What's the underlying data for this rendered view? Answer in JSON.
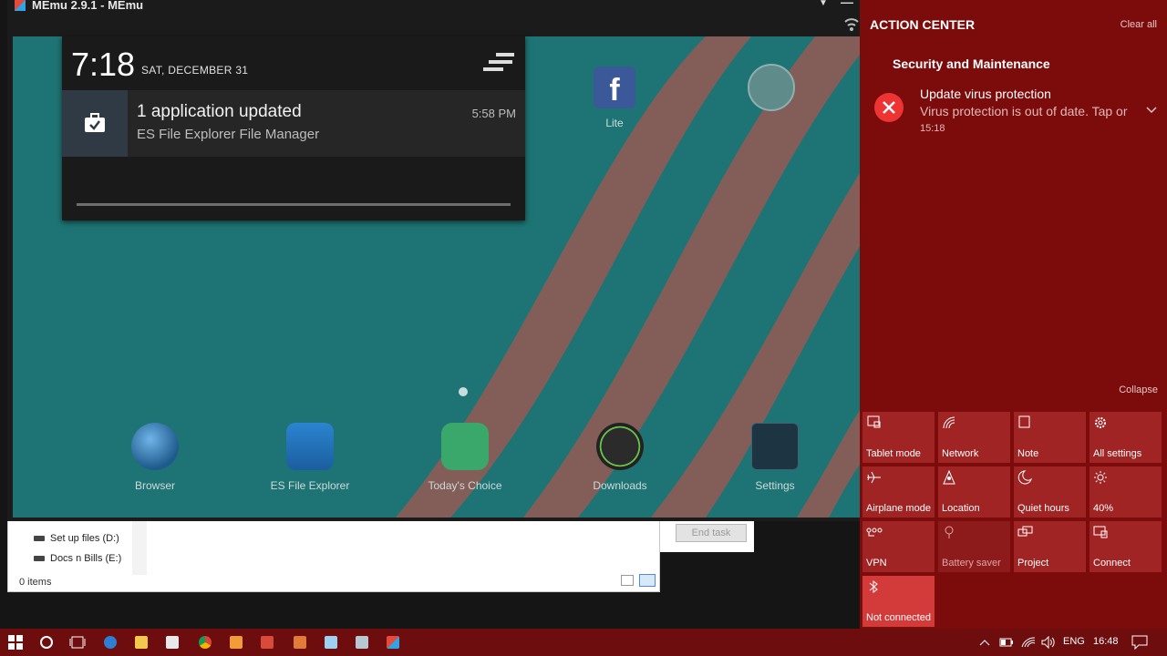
{
  "memu": {
    "title": "MEmu 2.9.1 - MEmu",
    "dock": [
      {
        "label": "Browser"
      },
      {
        "label": "ES File Explorer"
      },
      {
        "label": "Today's Choice"
      },
      {
        "label": "Downloads"
      },
      {
        "label": "Settings"
      }
    ],
    "home_icons": [
      {
        "label": "Lite"
      }
    ]
  },
  "notification_shade": {
    "time": "7:18",
    "date": "SAT, DECEMBER 31",
    "notification": {
      "title": "1 application updated",
      "subtitle": "ES File Explorer File Manager",
      "time": "5:58 PM"
    }
  },
  "explorer": {
    "drives": [
      "Set up files (D:)",
      "Docs n Bills (E:)"
    ],
    "status": "0 items"
  },
  "task_manager": {
    "end_task_label": "End task"
  },
  "action_center": {
    "title": "ACTION CENTER",
    "clear_all": "Clear all",
    "group": "Security and Maintenance",
    "notification": {
      "title": "Update virus protection",
      "body": "Virus protection is out of date. Tap or",
      "time": "15:18"
    },
    "collapse": "Collapse",
    "tiles": [
      {
        "label": "Tablet mode",
        "icon": "tablet-icon"
      },
      {
        "label": "Network",
        "icon": "network-icon"
      },
      {
        "label": "Note",
        "icon": "note-icon"
      },
      {
        "label": "All settings",
        "icon": "gear-icon"
      },
      {
        "label": "Airplane mode",
        "icon": "airplane-icon"
      },
      {
        "label": "Location",
        "icon": "location-icon"
      },
      {
        "label": "Quiet hours",
        "icon": "moon-icon"
      },
      {
        "label": "40%",
        "icon": "brightness-icon"
      },
      {
        "label": "VPN",
        "icon": "vpn-icon"
      },
      {
        "label": "Battery saver",
        "icon": "battery-saver-icon"
      },
      {
        "label": "Project",
        "icon": "project-icon"
      },
      {
        "label": "Connect",
        "icon": "connect-icon"
      },
      {
        "label": "Not connected",
        "icon": "bluetooth-icon"
      }
    ]
  },
  "taskbar": {
    "language": "ENG",
    "clock": "16:48"
  }
}
